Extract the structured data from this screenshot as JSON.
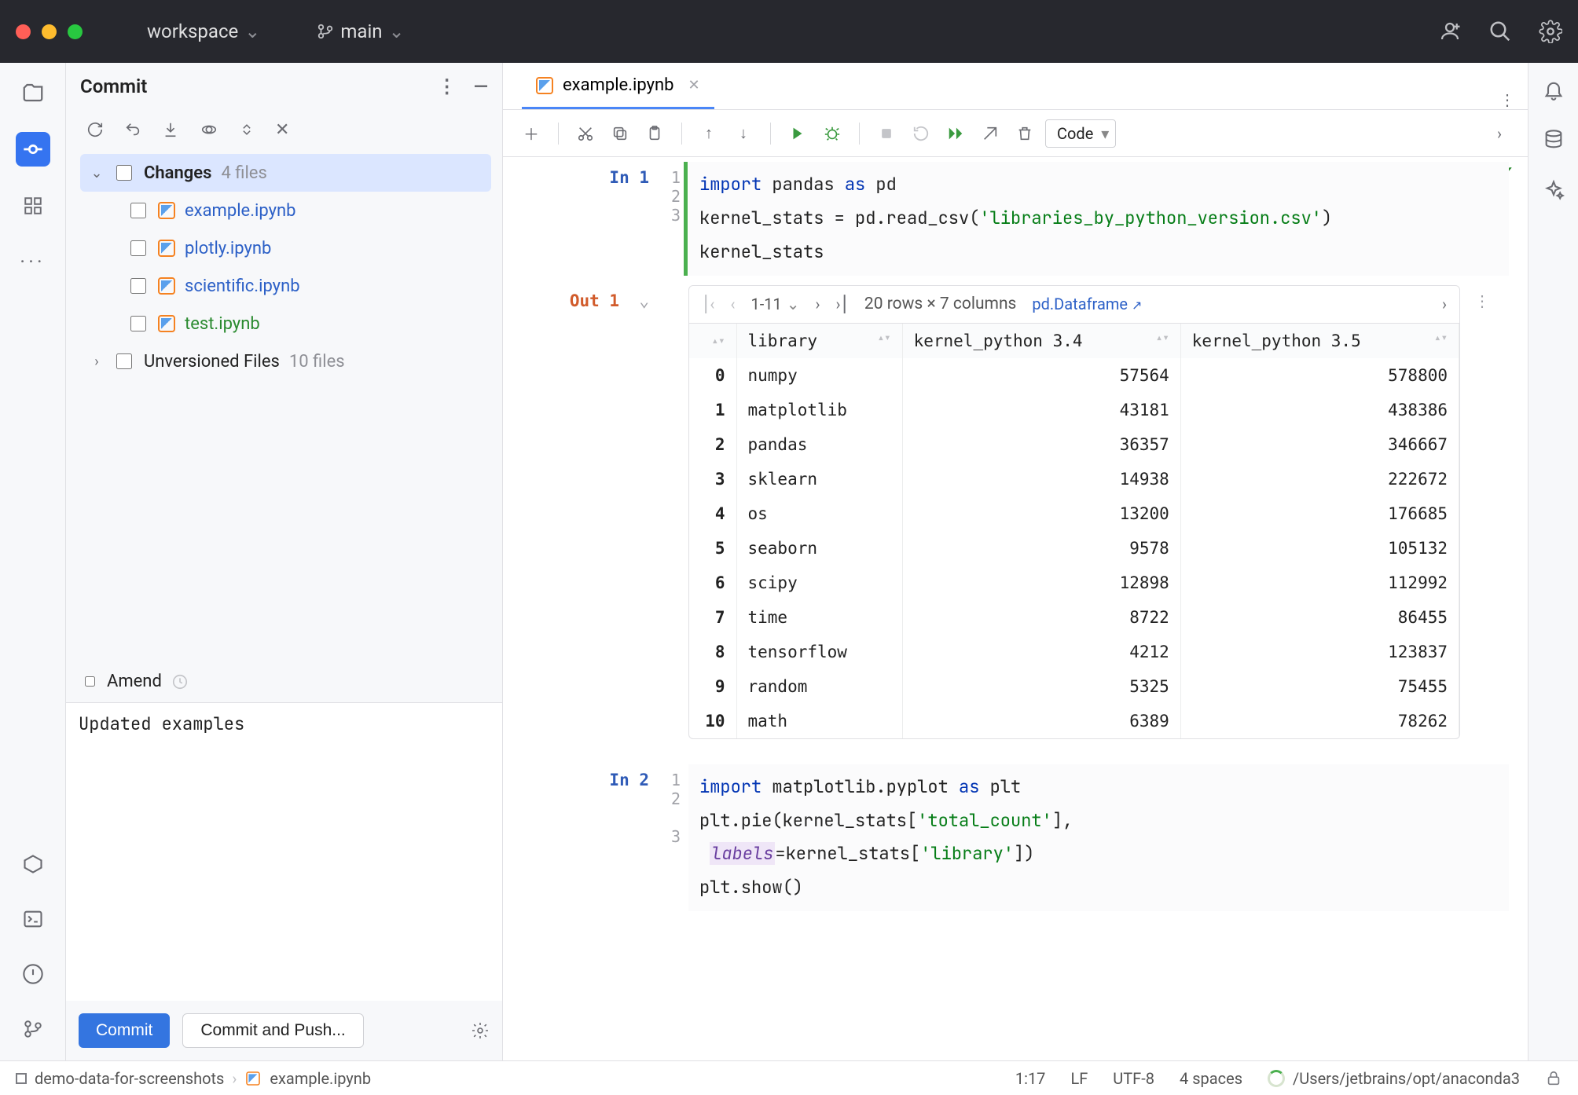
{
  "titlebar": {
    "workspace_label": "workspace",
    "branch_label": "main"
  },
  "commit_panel": {
    "title": "Commit",
    "changes_label": "Changes",
    "changes_count": "4 files",
    "files": [
      {
        "name": "example.ipynb",
        "color": "blue"
      },
      {
        "name": "plotly.ipynb",
        "color": "blue"
      },
      {
        "name": "scientific.ipynb",
        "color": "blue"
      },
      {
        "name": "test.ipynb",
        "color": "green"
      }
    ],
    "unversioned_label": "Unversioned Files",
    "unversioned_count": "10 files",
    "amend_label": "Amend",
    "message_value": "Updated examples",
    "commit_btn": "Commit",
    "commit_push_btn": "Commit and Push..."
  },
  "editor": {
    "tab_name": "example.ipynb",
    "cell_type": "Code",
    "cell1": {
      "prompt": "In 1",
      "lines": [
        "1",
        "2",
        "3"
      ],
      "code_html": "<span class='kw'>import</span> pandas <span class='as'>as</span> pd<br>kernel_stats = pd.read_csv(<span class='str'>'libraries_by_python_version.csv'</span>)<br>kernel_stats"
    },
    "out1": {
      "prompt": "Out 1",
      "range": "1-11",
      "dims": "20 rows × 7 columns",
      "df_label": "pd.Dataframe",
      "columns": [
        "",
        "library",
        "kernel_python 3.4",
        "kernel_python 3.5"
      ],
      "rows": [
        {
          "idx": "0",
          "library": "numpy",
          "c34": "57564",
          "c35": "578800"
        },
        {
          "idx": "1",
          "library": "matplotlib",
          "c34": "43181",
          "c35": "438386"
        },
        {
          "idx": "2",
          "library": "pandas",
          "c34": "36357",
          "c35": "346667"
        },
        {
          "idx": "3",
          "library": "sklearn",
          "c34": "14938",
          "c35": "222672"
        },
        {
          "idx": "4",
          "library": "os",
          "c34": "13200",
          "c35": "176685"
        },
        {
          "idx": "5",
          "library": "seaborn",
          "c34": "9578",
          "c35": "105132"
        },
        {
          "idx": "6",
          "library": "scipy",
          "c34": "12898",
          "c35": "112992"
        },
        {
          "idx": "7",
          "library": "time",
          "c34": "8722",
          "c35": "86455"
        },
        {
          "idx": "8",
          "library": "tensorflow",
          "c34": "4212",
          "c35": "123837"
        },
        {
          "idx": "9",
          "library": "random",
          "c34": "5325",
          "c35": "75455"
        },
        {
          "idx": "10",
          "library": "math",
          "c34": "6389",
          "c35": "78262"
        }
      ]
    },
    "cell2": {
      "prompt": "In 2",
      "lines": [
        "1",
        "2",
        "",
        "3"
      ],
      "code_html": "<span class='kw'>import</span> matplotlib.pyplot <span class='as'>as</span> plt<br>plt.pie(kernel_stats[<span class='str'>'total_count'</span>],<br>&nbsp;<span class='ital'>labels</span>=kernel_stats[<span class='str'>'library'</span>])<br>plt.show()"
    }
  },
  "statusbar": {
    "project": "demo-data-for-screenshots",
    "file": "example.ipynb",
    "caret": "1:17",
    "eol": "LF",
    "enc": "UTF-8",
    "indent": "4 spaces",
    "interp": "/Users/jetbrains/opt/anaconda3"
  }
}
